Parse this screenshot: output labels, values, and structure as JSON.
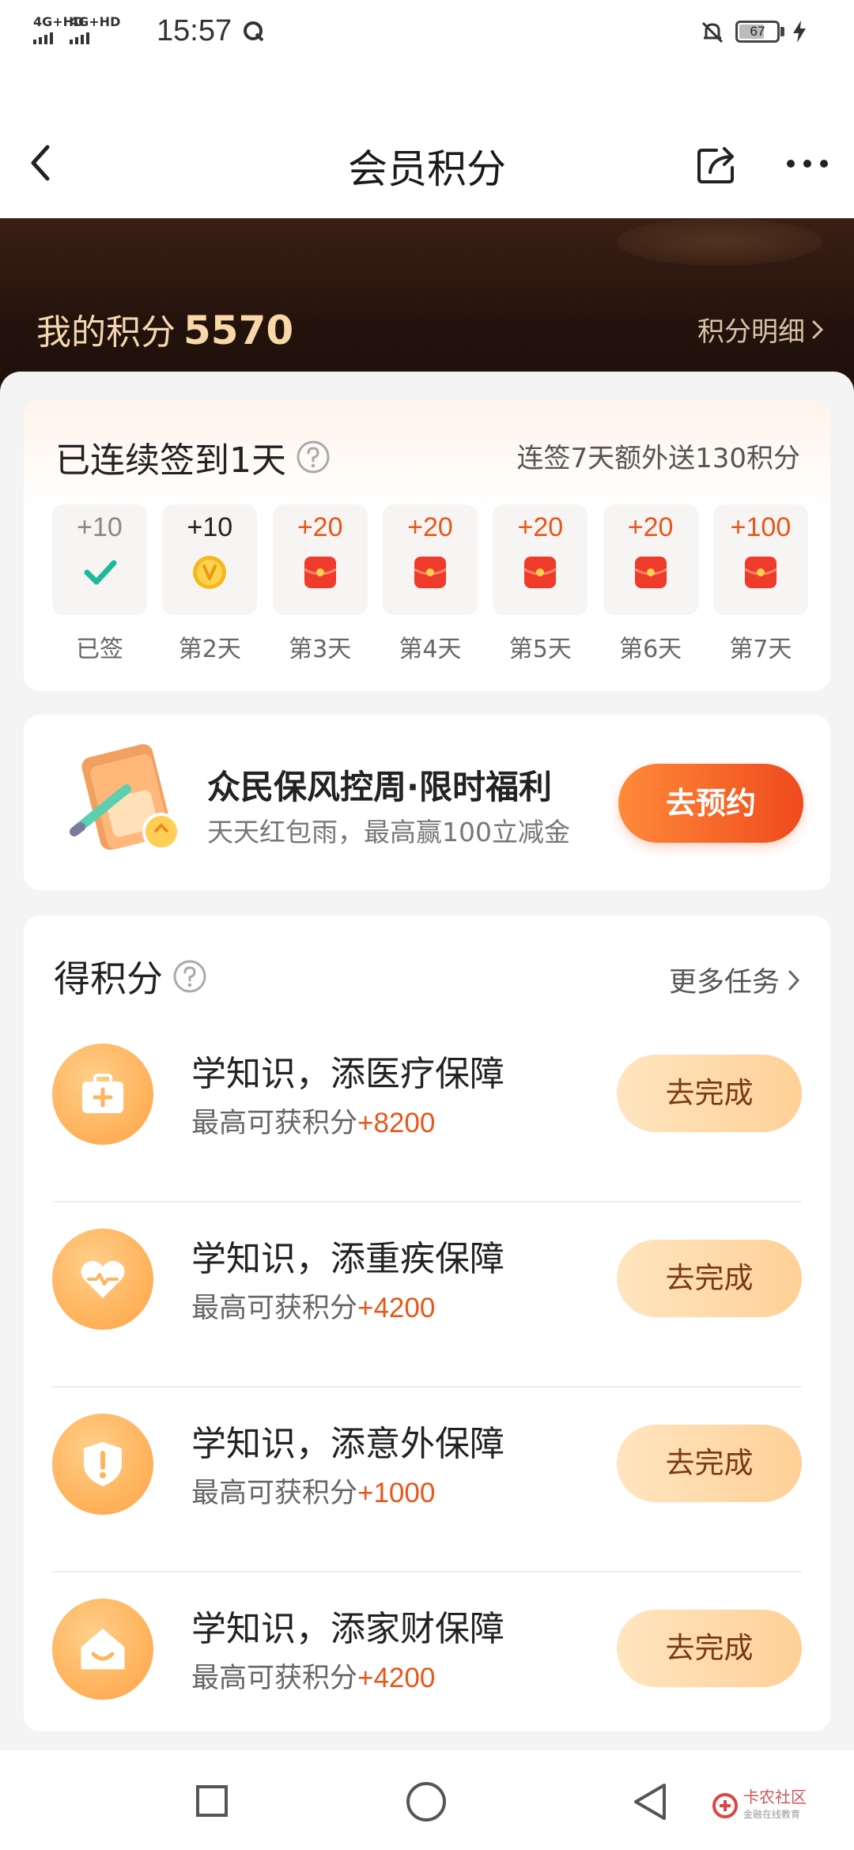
{
  "status_bar": {
    "net1": "4G+HD",
    "net2": "4G+HD",
    "time": "15:57",
    "battery": "67",
    "battery_level": 0.67
  },
  "nav": {
    "title": "会员积分",
    "back_icon": "chevron-left-icon",
    "share_icon": "share-icon",
    "more_icon": "more-dots-icon"
  },
  "header": {
    "points_label": "我的积分",
    "points_value": "5570",
    "detail_label": "积分明细"
  },
  "signin": {
    "title": "已连续签到1天",
    "bonus": "连签7天额外送130积分",
    "days": [
      {
        "points": "+10",
        "label": "已签",
        "icon": "check-icon"
      },
      {
        "points": "+10",
        "label": "第2天",
        "icon": "coin-icon"
      },
      {
        "points": "+20",
        "label": "第3天",
        "icon": "red-envelope-icon"
      },
      {
        "points": "+20",
        "label": "第4天",
        "icon": "red-envelope-icon"
      },
      {
        "points": "+20",
        "label": "第5天",
        "icon": "red-envelope-icon"
      },
      {
        "points": "+20",
        "label": "第6天",
        "icon": "red-envelope-icon"
      },
      {
        "points": "+100",
        "label": "第7天",
        "icon": "red-envelope-icon"
      }
    ]
  },
  "promo": {
    "title": "众民保风控周·限时福利",
    "subtitle": "天天红包雨，最高赢100立减金",
    "button": "去预约"
  },
  "tasks": {
    "title": "得积分",
    "more": "更多任务",
    "prefix": "最高可获积分",
    "items": [
      {
        "name": "学知识，添医疗保障",
        "points": "+8200",
        "button": "去完成",
        "icon": "medical-kit-icon"
      },
      {
        "name": "学知识，添重疾保障",
        "points": "+4200",
        "button": "去完成",
        "icon": "heart-pulse-icon"
      },
      {
        "name": "学知识，添意外保障",
        "points": "+1000",
        "button": "去完成",
        "icon": "shield-alert-icon"
      },
      {
        "name": "学知识，添家财保障",
        "points": "+4200",
        "button": "去完成",
        "icon": "house-icon"
      }
    ]
  },
  "watermark": {
    "name": "卡农社区",
    "sub": "金融在线教育"
  },
  "colors": {
    "accent_orange": "#e8561a",
    "header_dark": "#23120c",
    "gold_text": "#f8d8a8"
  }
}
